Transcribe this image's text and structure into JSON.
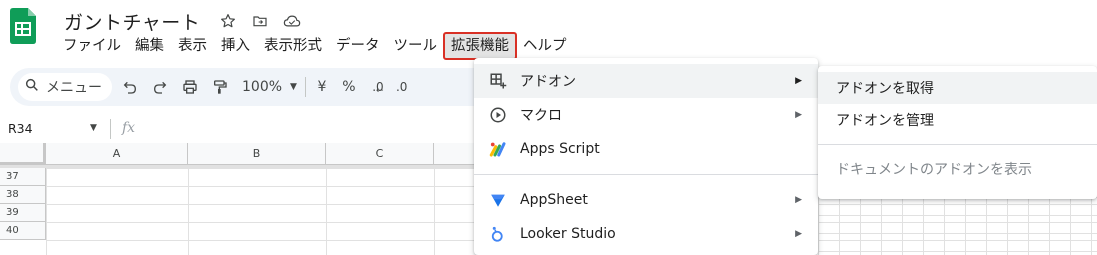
{
  "header": {
    "title": "ガントチャート",
    "icons": [
      "star-icon",
      "move-to-folder-icon",
      "cloud-saved-icon"
    ]
  },
  "menubar": {
    "items": [
      "ファイル",
      "編集",
      "表示",
      "挿入",
      "表示形式",
      "データ",
      "ツール",
      "拡張機能",
      "ヘルプ"
    ],
    "active_index": 7,
    "accent_color": "#d93025"
  },
  "toolbar": {
    "search_label": "メニュー",
    "zoom": "100%",
    "currency": "¥",
    "percent": "%",
    "decimal_decrease": ".0",
    "decimal_increase": ".0"
  },
  "formula_bar": {
    "cell_ref": "R34",
    "fx": "fx"
  },
  "grid": {
    "columns": [
      "A",
      "B",
      "C"
    ],
    "rows": [
      "37",
      "38",
      "39",
      "40"
    ]
  },
  "extensions_menu": {
    "items": [
      {
        "label": "アドオン",
        "icon": "addons-icon",
        "has_submenu": true
      },
      {
        "label": "マクロ",
        "icon": "macro-icon",
        "has_submenu": true
      },
      {
        "label": "Apps Script",
        "icon": "apps-script-icon",
        "has_submenu": false
      },
      {
        "label": "AppSheet",
        "icon": "appsheet-icon",
        "has_submenu": true
      },
      {
        "label": "Looker Studio",
        "icon": "looker-studio-icon",
        "has_submenu": true
      }
    ]
  },
  "addons_submenu": {
    "items": [
      "アドオンを取得",
      "アドオンを管理",
      "ドキュメントのアドオンを表示"
    ]
  }
}
